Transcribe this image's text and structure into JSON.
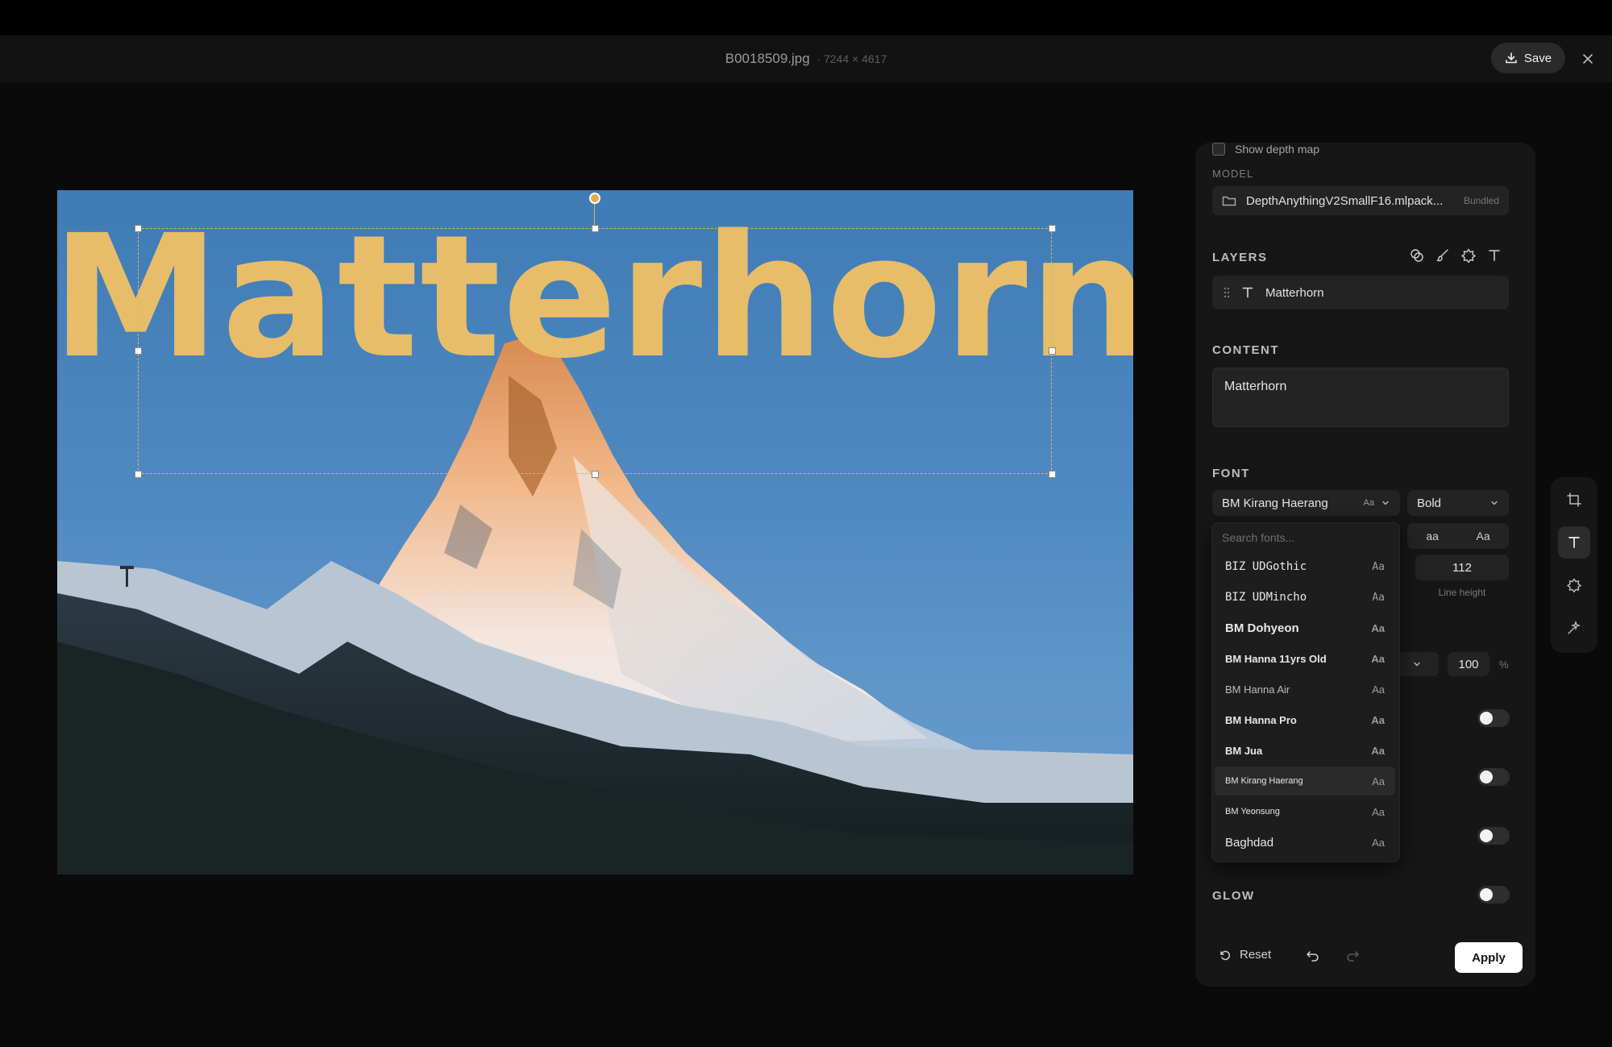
{
  "header": {
    "filename": "B0018509.jpg",
    "dimensions": "· 7244 × 4617",
    "save_label": "Save"
  },
  "canvas": {
    "overlay_text": "Matterhorn",
    "text_color": "#e8bd6a"
  },
  "panel": {
    "depth_map_label": "Show depth map",
    "model_label": "MODEL",
    "model_name": "DepthAnythingV2SmallF16.mlpack...",
    "model_tag": "Bundled",
    "layers_label": "LAYERS",
    "layer_name": "Matterhorn",
    "content_label": "CONTENT",
    "content_value": "Matterhorn",
    "font_label": "FONT",
    "font_family": "BM Kirang Haerang",
    "font_aa": "Aa",
    "font_weight": "Bold",
    "case_lower": "aa",
    "case_title": "Aa",
    "line_height_value": "112",
    "line_height_label": "Line height",
    "opacity_value": "100",
    "opacity_unit": "%",
    "glow_label": "GLOW",
    "reset_label": "Reset",
    "apply_label": "Apply"
  },
  "font_dropdown": {
    "search_placeholder": "Search fonts...",
    "items": [
      {
        "name": "BIZ UDGothic",
        "aa": "Aa"
      },
      {
        "name": "BIZ UDMincho",
        "aa": "Aa"
      },
      {
        "name": "BM Dohyeon",
        "aa": "Aa"
      },
      {
        "name": "BM Hanna 11yrs Old",
        "aa": "Aa"
      },
      {
        "name": "BM Hanna Air",
        "aa": "Aa"
      },
      {
        "name": "BM Hanna Pro",
        "aa": "Aa"
      },
      {
        "name": "BM Jua",
        "aa": "Aa"
      },
      {
        "name": "BM Kirang Haerang",
        "aa": "Aa"
      },
      {
        "name": "BM Yeonsung",
        "aa": "Aa"
      },
      {
        "name": "Baghdad",
        "aa": "Aa"
      }
    ]
  },
  "tools": [
    "crop-icon",
    "text-icon",
    "sticker-icon",
    "magic-icon"
  ]
}
